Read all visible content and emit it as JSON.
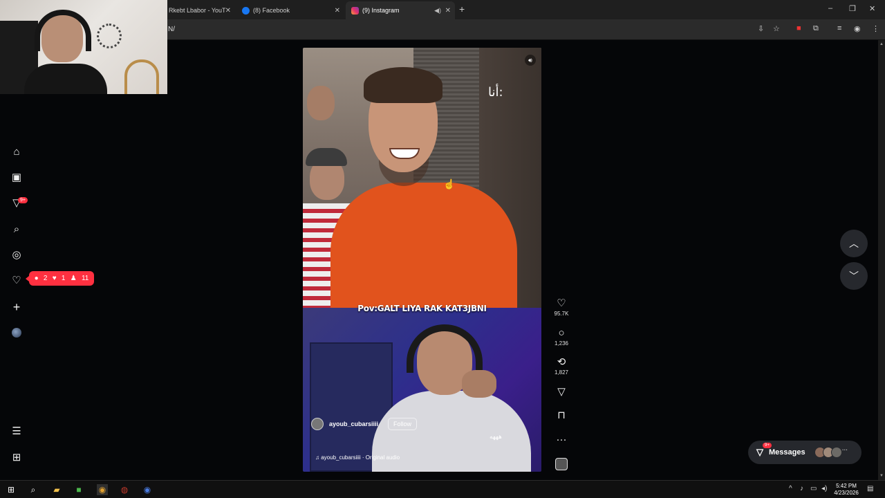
{
  "browser": {
    "tabs": [
      {
        "label": "Rkebt Lbabor - YouT",
        "active": false
      },
      {
        "label": "(8) Facebook",
        "active": false
      },
      {
        "label": "(9) Instagram",
        "active": true
      }
    ],
    "url": "N/",
    "new_tab": "+",
    "window_controls": [
      "–",
      "❐",
      "✕"
    ],
    "accent": "#ff3040"
  },
  "sidebar": {
    "badge": "9+",
    "notifications": {
      "comments": "2",
      "likes": "1",
      "follows": "11"
    }
  },
  "reel": {
    "overlay_text": "أنا:",
    "caption": "Pov:GALT LIYA RAK KAT3JBNI",
    "bottom_text": "هههه",
    "author": "ayoub_cubarsiiii",
    "follow_label": "Follow",
    "audio": "ayoub_cubarsiiii · Original audio",
    "likes": "95.7K",
    "comments": "1,236",
    "reposts": "1,827",
    "more": "···"
  },
  "messages": {
    "label": "Messages",
    "badge": "9+",
    "more": "···"
  },
  "taskbar": {
    "time": "5:42 PM",
    "date": "4/23/2026"
  }
}
